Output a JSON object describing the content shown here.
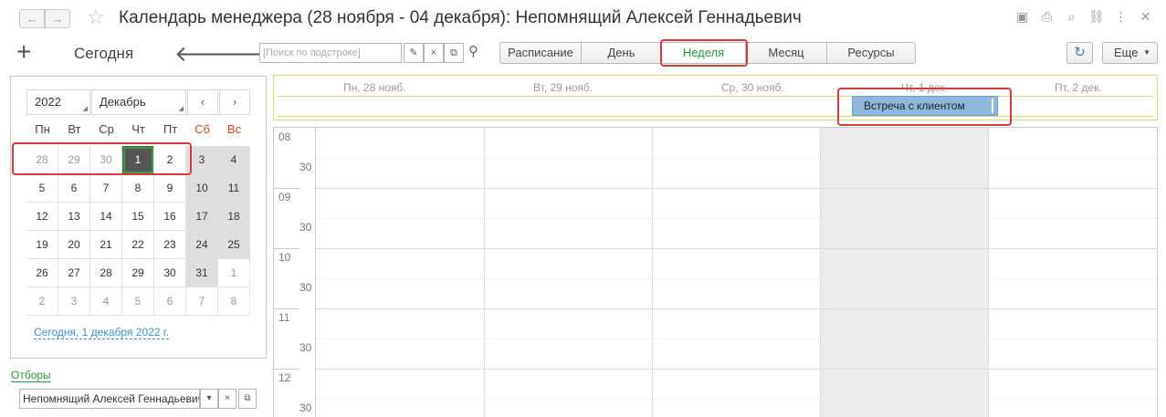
{
  "window": {
    "title": "Календарь менеджера (28 ноября - 04 декабря): Непомнящий Алексей Геннадьевич",
    "icons": [
      "save-icon",
      "print-icon",
      "preview-icon",
      "link-icon",
      "more-icon",
      "close-icon"
    ]
  },
  "toolbar": {
    "add_label": "+",
    "today_label": "Сегодня",
    "search_placeholder": "[Поиск по подстроке]",
    "views": [
      {
        "label": "Расписание",
        "active": false
      },
      {
        "label": "День",
        "active": false
      },
      {
        "label": "Неделя",
        "active": true
      },
      {
        "label": "Месяц",
        "active": false
      },
      {
        "label": "Ресурсы",
        "active": false
      }
    ],
    "more_label": "Еще"
  },
  "calendar": {
    "year": "2022",
    "month": "Декабрь",
    "weekdays": [
      "Пн",
      "Вт",
      "Ср",
      "Чт",
      "Пт",
      "Сб",
      "Вс"
    ],
    "weeks": [
      [
        "28",
        "29",
        "30",
        "1",
        "2",
        "3",
        "4"
      ],
      [
        "5",
        "6",
        "7",
        "8",
        "9",
        "10",
        "11"
      ],
      [
        "12",
        "13",
        "14",
        "15",
        "16",
        "17",
        "18"
      ],
      [
        "19",
        "20",
        "21",
        "22",
        "23",
        "24",
        "25"
      ],
      [
        "26",
        "27",
        "28",
        "29",
        "30",
        "31",
        "1"
      ],
      [
        "2",
        "3",
        "4",
        "5",
        "6",
        "7",
        "8"
      ]
    ],
    "today_link": "Сегодня, 1 декабря 2022 г."
  },
  "filters": {
    "label": "Отборы",
    "value": "Непомнящий Алексей Геннадьевич"
  },
  "week_view": {
    "days": [
      "Пн, 28 нояб.",
      "Вт, 29 нояб.",
      "Ср, 30 нояб.",
      "Чт, 1 дек.",
      "Пт, 2 дек."
    ],
    "event": "Встреча с клиентом",
    "hours": [
      "08",
      "09",
      "10",
      "11",
      "12"
    ],
    "half_label": "30"
  },
  "colors": {
    "accent_green": "#2a9a3a",
    "highlight_red": "#d63a3a",
    "event_blue": "#8fb8df",
    "weekend_red": "#d9481f"
  }
}
